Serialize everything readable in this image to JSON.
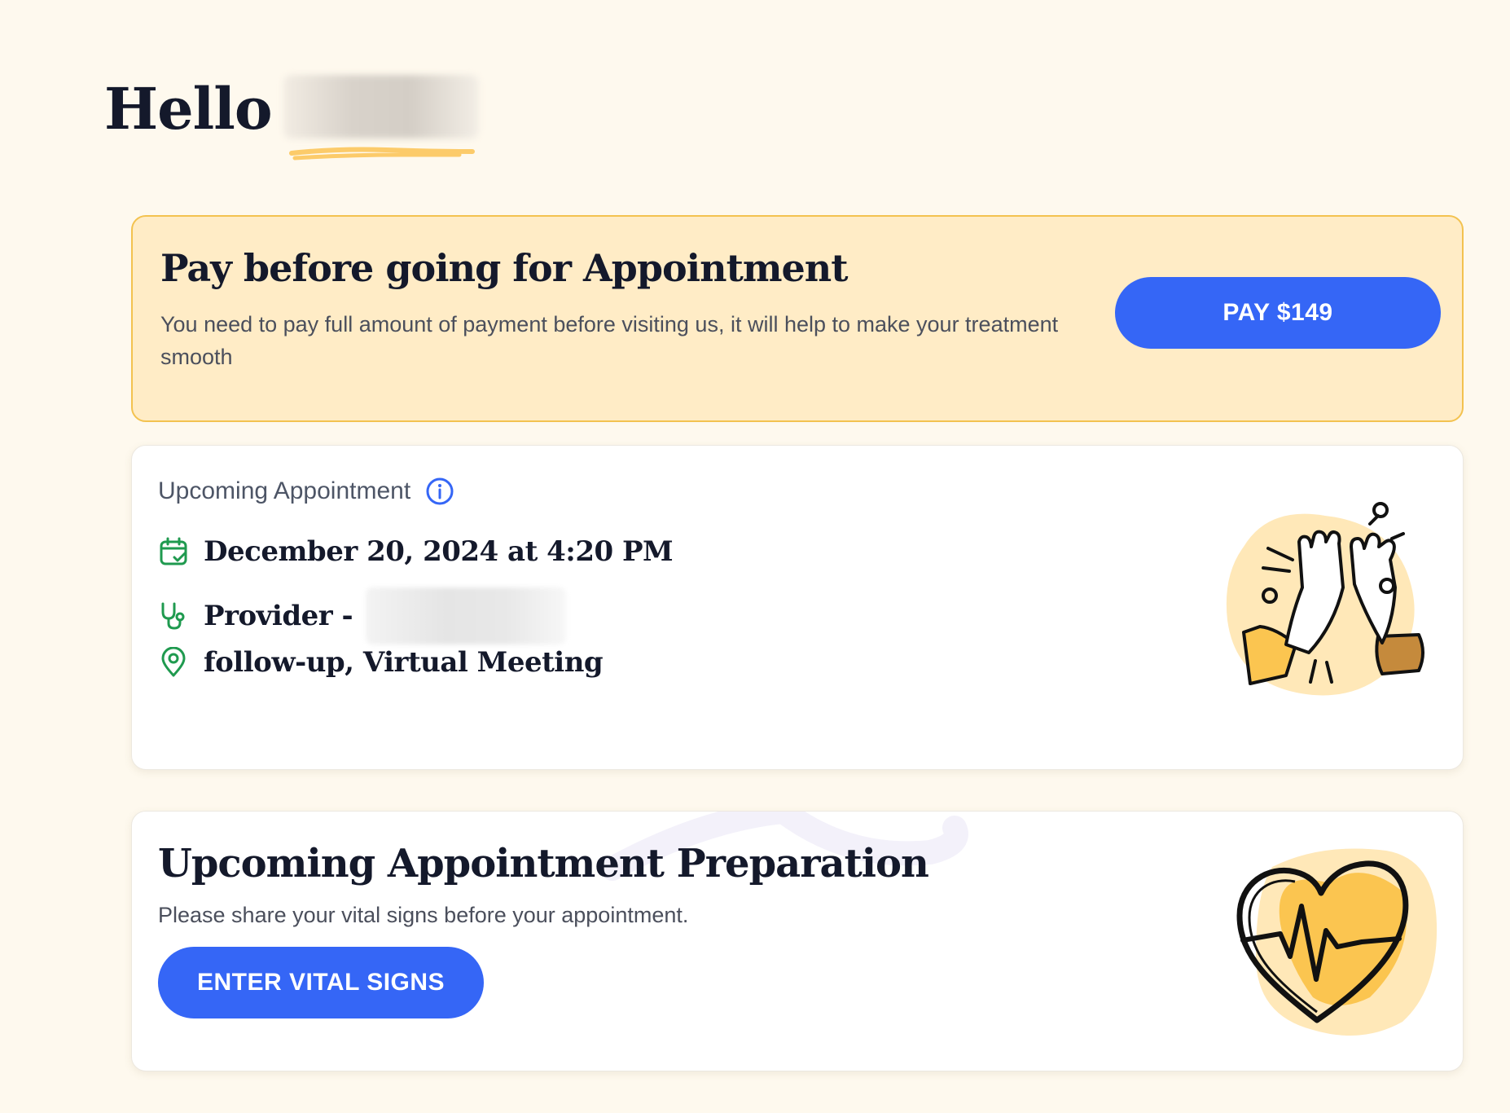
{
  "greeting": {
    "hello": "Hello"
  },
  "payment_card": {
    "title": "Pay before going for Appointment",
    "description": "You need to pay full amount of payment before visiting us, it will help to make your treatment smooth",
    "pay_button_label": "PAY $149"
  },
  "appointment_card": {
    "label": "Upcoming Appointment",
    "datetime": "December 20, 2024 at 4:20 PM",
    "provider_prefix": "Provider -",
    "location": "follow-up, Virtual Meeting",
    "icons": {
      "info": "info-icon",
      "date": "calendar-check-icon",
      "provider": "stethoscope-icon",
      "location": "map-pin-icon"
    }
  },
  "preparation_card": {
    "title": "Upcoming Appointment Preparation",
    "description": "Please share your vital signs before your appointment.",
    "button_label": "ENTER VITAL SIGNS"
  },
  "colors": {
    "background": "#fef9ee",
    "accent_blue": "#3566f6",
    "payment_card_bg": "#ffecc6",
    "payment_card_border": "#f3c24f",
    "icon_green": "#1f9a4f",
    "illustration_yellow": "#fbc550"
  }
}
